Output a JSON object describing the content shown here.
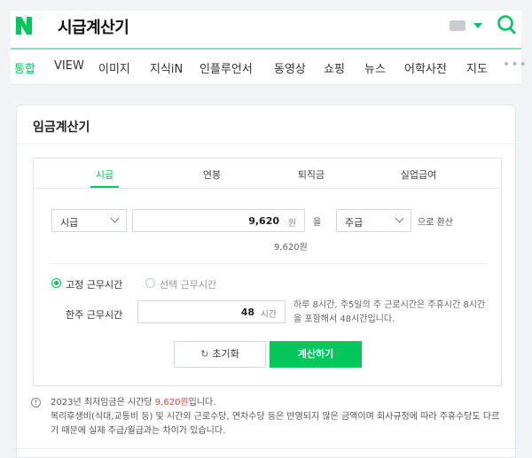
{
  "header": {
    "query": "시급계산기"
  },
  "tabs": [
    "통합",
    "VIEW",
    "이미지",
    "지식iN",
    "인플루언서",
    "동영상",
    "쇼핑",
    "뉴스",
    "어학사전",
    "지도"
  ],
  "card": {
    "title": "임금계산기"
  },
  "calc": {
    "tabs": [
      "시급",
      "연봉",
      "퇴직금",
      "실업급여"
    ],
    "input_unit_select": "시급",
    "amount_value": "9,620",
    "amount_unit": "원",
    "eul": "을",
    "target_unit_select": "주급",
    "convert_text": "으로 환산",
    "sub_result": "9,620원",
    "radio_fixed": "고정 근무시간",
    "radio_select": "선택 근무시간",
    "week_label": "한주 근무시간",
    "hours_value": "48",
    "hours_unit": "시간",
    "hours_desc": "하루 8시간, 주5일의 주 근로시간은 주휴시간 8시간을 포함해서 48시간입니다.",
    "reset_label": "초기화",
    "calc_label": "계산하기"
  },
  "notice": {
    "line1_prefix": "2023년 최저임금은 시간당 ",
    "line1_highlight": "9,620원",
    "line1_suffix": "입니다.",
    "line2": "복리후생비(식대,교통비 등) 및 시간외 근로수당, 연차수당 등은 반영되지 않은 금액이며 회사규정에 따라 주휴수당도 다르기 때문에 실제 주급/월급과는 차이가 있습니다."
  },
  "colors": {
    "brand": "#03c75a",
    "highlight": "#e8453c"
  }
}
